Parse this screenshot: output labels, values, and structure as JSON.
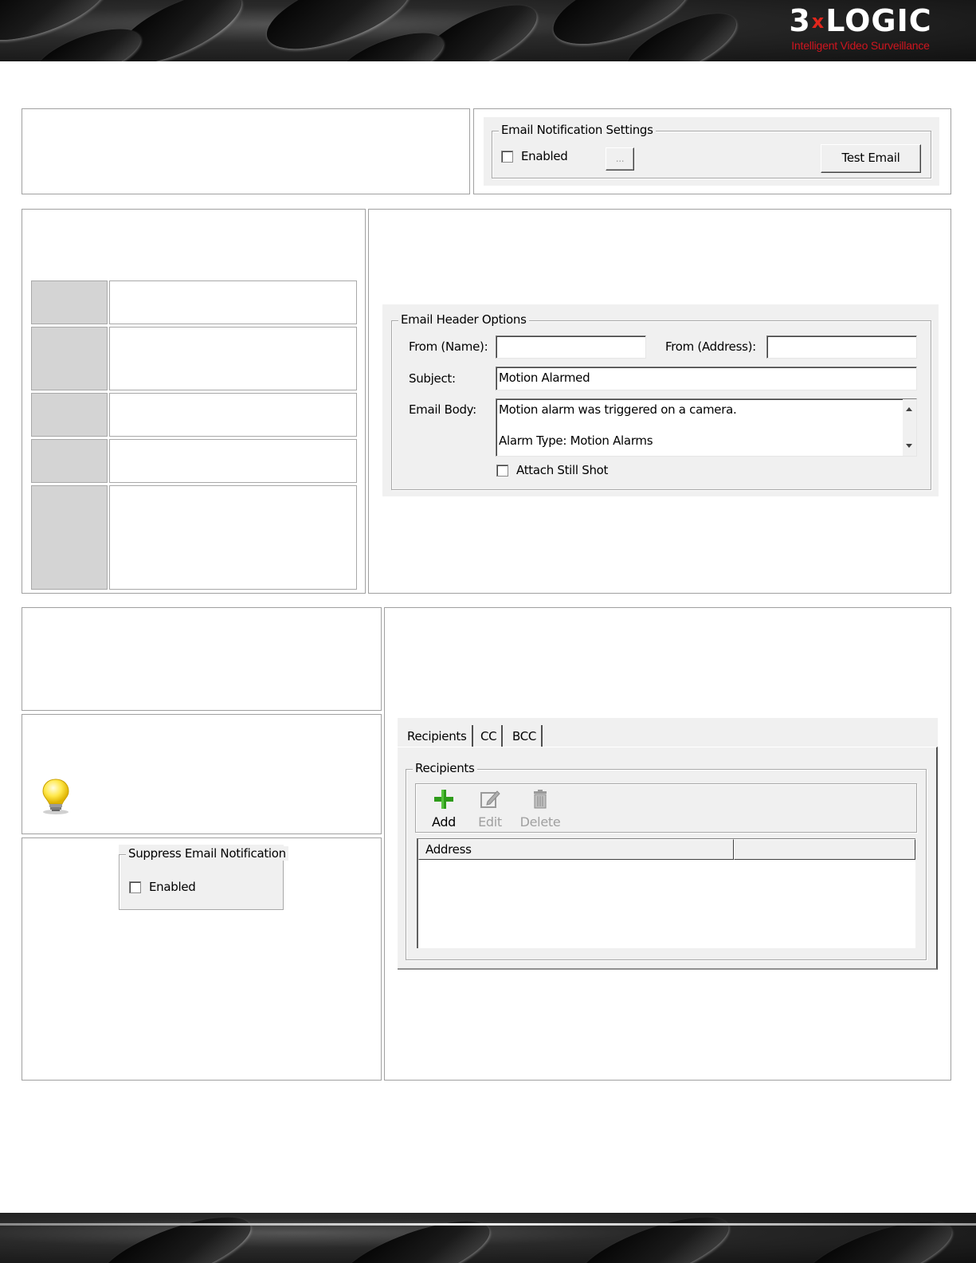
{
  "branding": {
    "logo_wordmark_left": "3",
    "logo_wordmark_x": "x",
    "logo_wordmark_right": "LOGIC",
    "logo_tagline": "Intelligent Video Surveillance"
  },
  "email_notification_settings": {
    "group_label": "Email Notification Settings",
    "enabled_label": "Enabled",
    "enabled_checked": false,
    "browse_label": "...",
    "test_email_label": "Test Email"
  },
  "email_header_options": {
    "group_label": "Email Header Options",
    "from_name_label": "From (Name):",
    "from_name_value": "",
    "from_address_label": "From (Address):",
    "from_address_value": "",
    "subject_label": "Subject:",
    "subject_value": "Motion Alarmed",
    "body_label": "Email Body:",
    "body_line_1": "Motion alarm was triggered on a camera.",
    "body_line_2": "Alarm Type: Motion Alarms",
    "attach_label": "Attach Still Shot",
    "attach_checked": false
  },
  "suppress_email_notification": {
    "group_label": "Suppress Email Notification",
    "enabled_label": "Enabled",
    "enabled_checked": false
  },
  "recipients_panel": {
    "tabs": [
      {
        "label": "Recipients"
      },
      {
        "label": "CC"
      },
      {
        "label": "BCC"
      }
    ],
    "group_label": "Recipients",
    "toolbar": {
      "add_label": "Add",
      "edit_label": "Edit",
      "delete_label": "Delete"
    },
    "columns": [
      {
        "label": "Address"
      },
      {
        "label": ""
      }
    ]
  }
}
